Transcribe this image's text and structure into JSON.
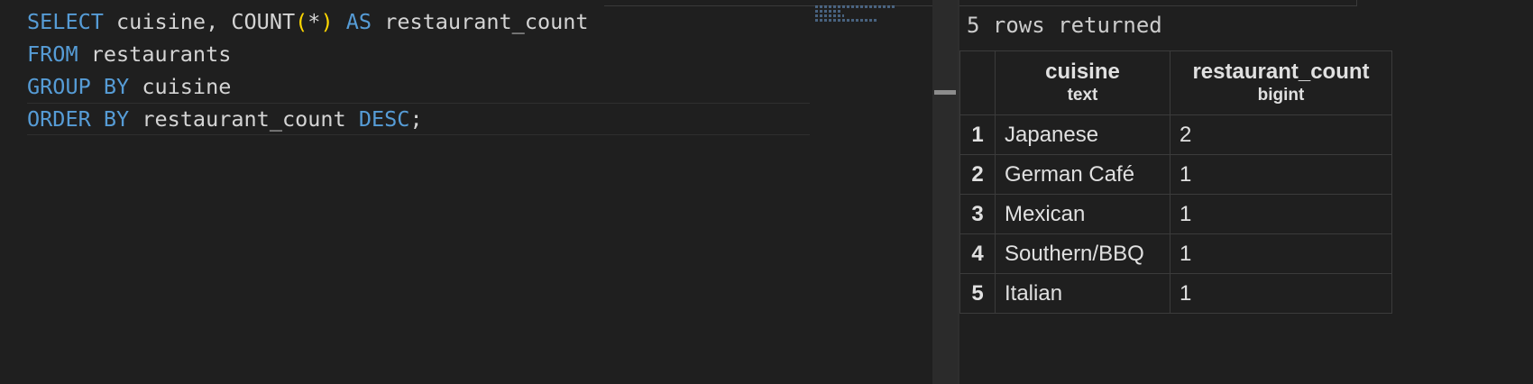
{
  "editor": {
    "lines": [
      [
        {
          "t": "SELECT",
          "k": "kw"
        },
        {
          "t": " cuisine, ",
          "k": "id"
        },
        {
          "t": "COUNT",
          "k": "fn"
        },
        {
          "t": "(",
          "k": "paren"
        },
        {
          "t": "*",
          "k": "punc"
        },
        {
          "t": ")",
          "k": "paren"
        },
        {
          "t": " ",
          "k": "id"
        },
        {
          "t": "AS",
          "k": "kw"
        },
        {
          "t": " restaurant_count",
          "k": "id"
        }
      ],
      [
        {
          "t": "FROM",
          "k": "kw"
        },
        {
          "t": " restaurants",
          "k": "id"
        }
      ],
      [
        {
          "t": "GROUP BY",
          "k": "kw"
        },
        {
          "t": " cuisine",
          "k": "id"
        }
      ],
      [
        {
          "t": "ORDER BY",
          "k": "kw"
        },
        {
          "t": " restaurant_count ",
          "k": "id"
        },
        {
          "t": "DESC",
          "k": "kw"
        },
        {
          "t": ";",
          "k": "punc"
        }
      ]
    ]
  },
  "results": {
    "row_count_text": "5 rows returned",
    "columns": [
      {
        "name": "cuisine",
        "type": "text"
      },
      {
        "name": "restaurant_count",
        "type": "bigint"
      }
    ],
    "rows": [
      {
        "num": "1",
        "cuisine": "Japanese",
        "count": "2"
      },
      {
        "num": "2",
        "cuisine": "German Café",
        "count": "1"
      },
      {
        "num": "3",
        "cuisine": "Mexican",
        "count": "1"
      },
      {
        "num": "4",
        "cuisine": "Southern/BBQ",
        "count": "1"
      },
      {
        "num": "5",
        "cuisine": "Italian",
        "count": "1"
      }
    ]
  },
  "colors": {
    "keyword": "#569cd6",
    "identifier": "#d4d4d4",
    "paren": "#ffd700",
    "background": "#1f1f1f",
    "grid_border": "#3b3b3b"
  }
}
